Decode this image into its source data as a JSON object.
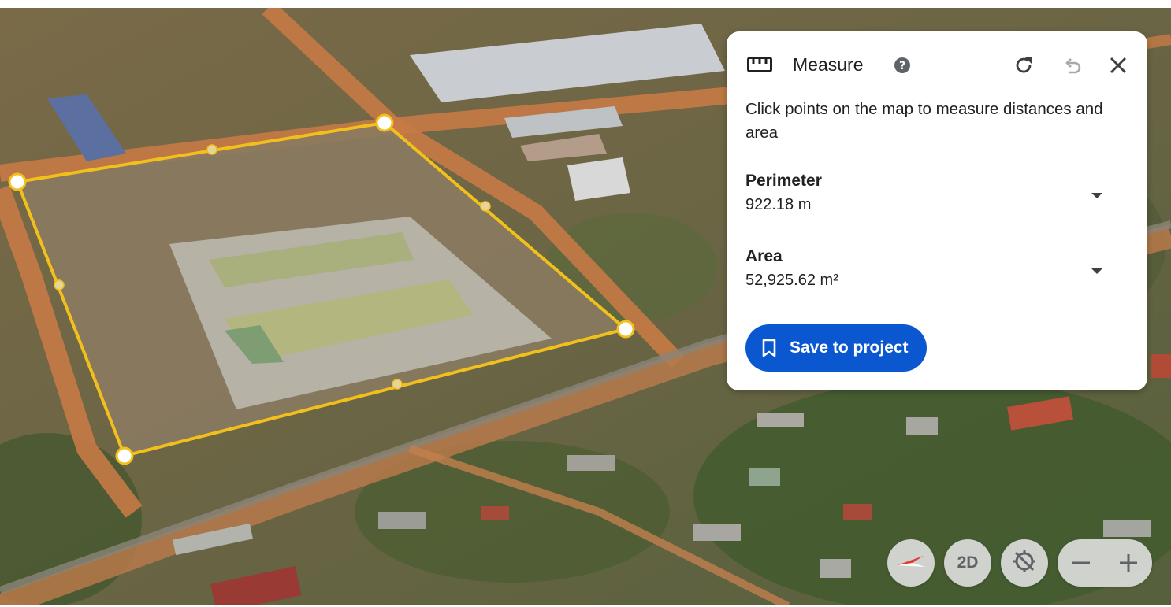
{
  "panel": {
    "title": "Measure",
    "instructions": "Click points on the map to measure distances and area",
    "perimeter": {
      "label": "Perimeter",
      "value": "922.18 m"
    },
    "area": {
      "label": "Area",
      "value": "52,925.62 m²"
    },
    "save_label": "Save to project",
    "icons": [
      "ruler-icon",
      "help-icon",
      "redo-icon",
      "undo-icon",
      "close-icon",
      "chevron-down-icon",
      "bookmark-icon"
    ]
  },
  "controls": {
    "view_mode_label": "2D",
    "icons": [
      "compass-icon",
      "orientation-reset-icon",
      "zoom-out-icon",
      "zoom-in-icon"
    ]
  },
  "map": {
    "measure_line_color": "#f2c01d",
    "vertex_count": 4
  },
  "colors": {
    "accent": "#0b57d0",
    "panel_bg": "#ffffff",
    "control_bg": "#e2e2e2"
  }
}
